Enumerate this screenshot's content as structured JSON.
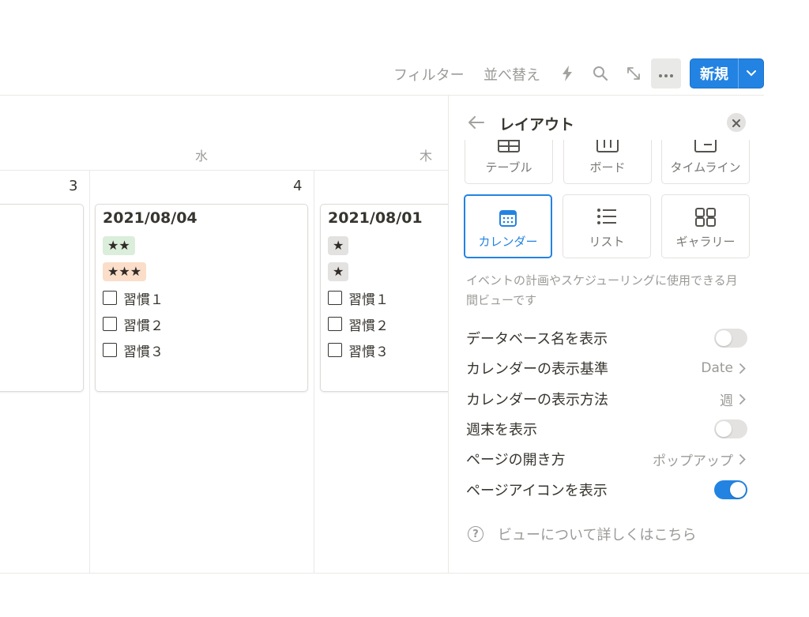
{
  "toolbar": {
    "filter_label": "フィルター",
    "sort_label": "並べ替え",
    "icons": [
      "lightning-icon",
      "search-icon",
      "expand-icon",
      "more-icon"
    ],
    "new_label": "新規"
  },
  "calendar": {
    "weekdays": [
      "水",
      "木"
    ],
    "day_numbers": [
      "3",
      "4"
    ],
    "cards": [
      {
        "title": "2021/08/04",
        "tags": [
          {
            "text": "★★",
            "color": "#dbeddb"
          },
          {
            "text": "★★★",
            "color": "#fadec9"
          }
        ],
        "habits": [
          "習慣１",
          "習慣２",
          "習慣３"
        ]
      },
      {
        "title": "2021/08/01",
        "tags": [
          {
            "text": "★",
            "color": "#e3e2e0"
          },
          {
            "text": "★",
            "color": "#e3e2e0"
          }
        ],
        "habits": [
          "習慣１",
          "習慣２",
          "習慣３"
        ]
      }
    ]
  },
  "panel": {
    "title": "レイアウト",
    "layouts": [
      {
        "label": "テーブル",
        "icon": "table-icon"
      },
      {
        "label": "ボード",
        "icon": "board-icon"
      },
      {
        "label": "タイムライン",
        "icon": "timeline-icon"
      },
      {
        "label": "カレンダー",
        "icon": "calendar-icon",
        "selected": true
      },
      {
        "label": "リスト",
        "icon": "list-icon"
      },
      {
        "label": "ギャラリー",
        "icon": "gallery-icon"
      }
    ],
    "description": "イベントの計画やスケジューリングに使用できる月間ビューです",
    "settings": [
      {
        "label": "データベース名を表示",
        "type": "toggle",
        "on": false
      },
      {
        "label": "カレンダーの表示基準",
        "type": "select",
        "value": "Date"
      },
      {
        "label": "カレンダーの表示方法",
        "type": "select",
        "value": "週"
      },
      {
        "label": "週末を表示",
        "type": "toggle",
        "on": false
      },
      {
        "label": "ページの開き方",
        "type": "select",
        "value": "ポップアップ"
      },
      {
        "label": "ページアイコンを表示",
        "type": "toggle",
        "on": true
      }
    ],
    "help_text": "ビューについて詳しくはこちら"
  },
  "colors": {
    "accent": "#2383e2",
    "muted_text": "#9b9a97",
    "border": "#e9e9e7"
  }
}
